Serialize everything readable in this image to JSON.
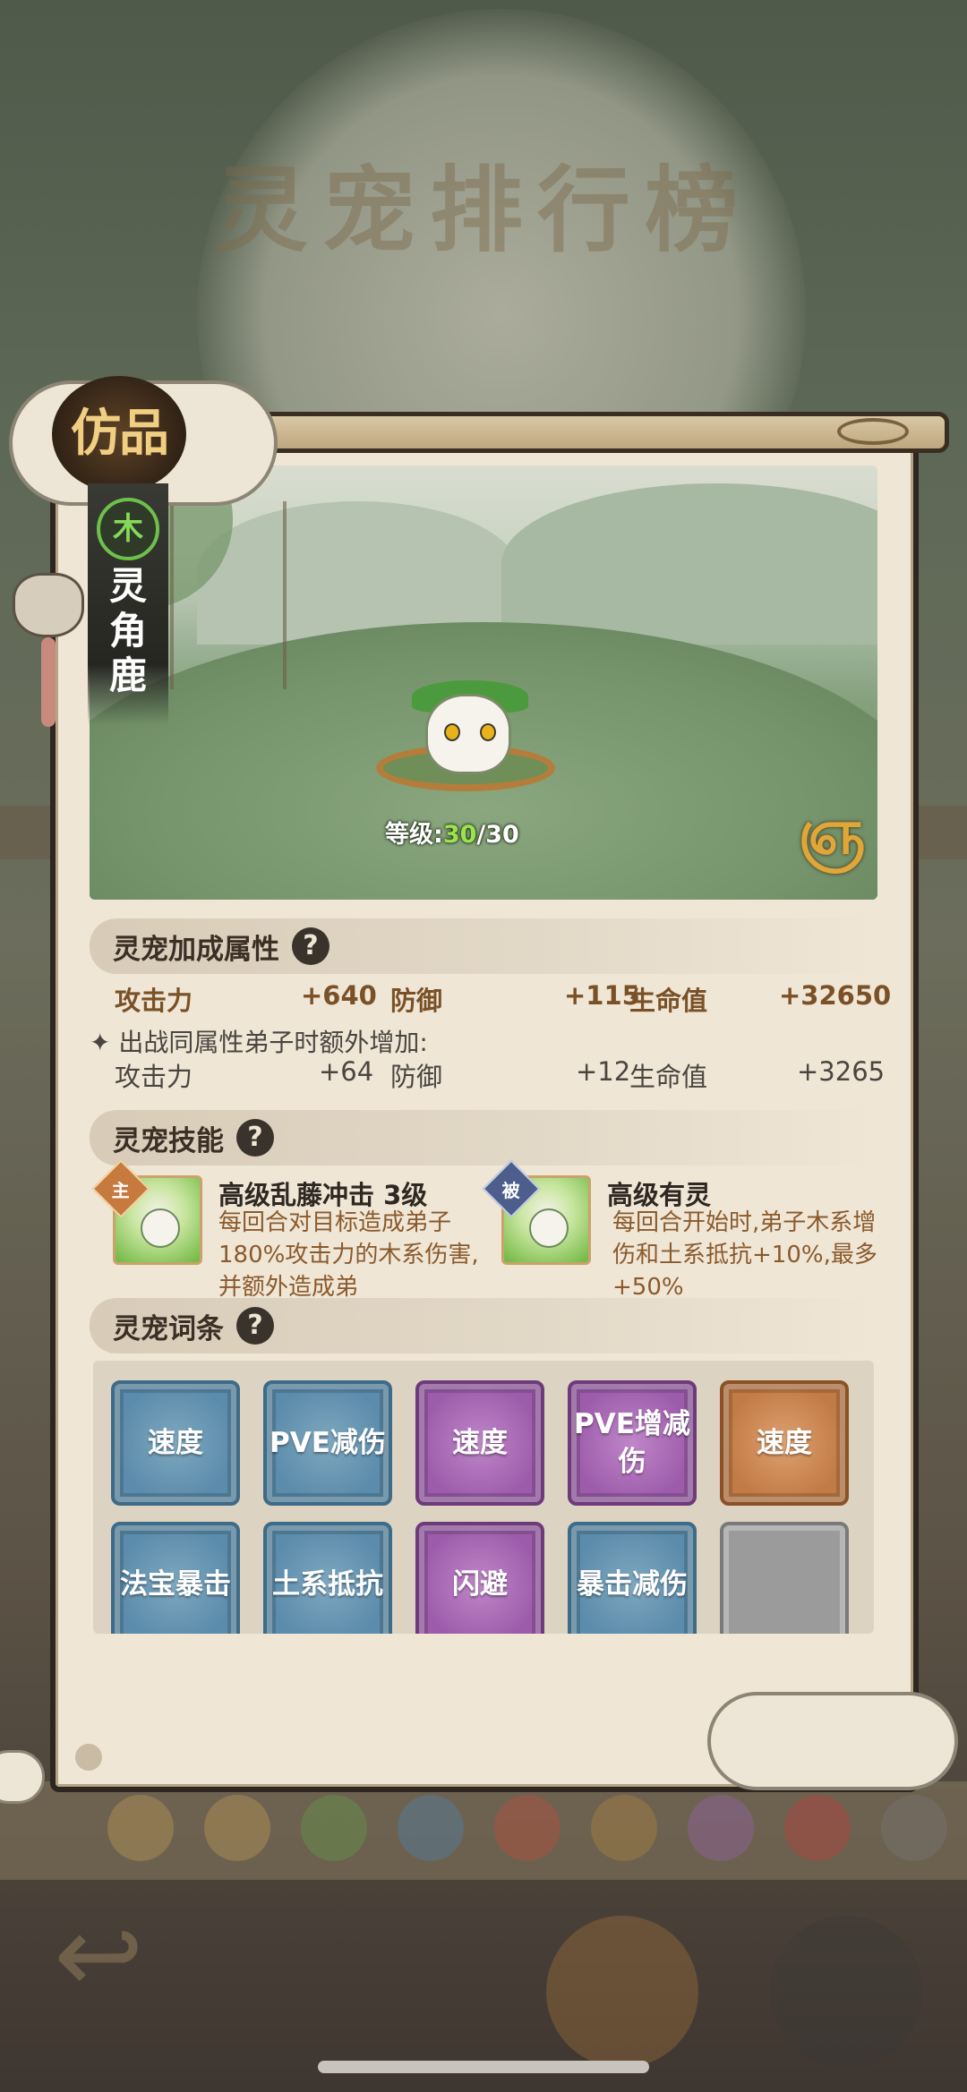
{
  "background": {
    "title": "灵宠排行榜"
  },
  "pet": {
    "grade": "仿品",
    "element": "木",
    "name": "灵角鹿",
    "level_label": "等级:",
    "level_current": "30",
    "level_max": "/30"
  },
  "attributes": {
    "title": "灵宠加成属性",
    "rows": [
      {
        "label": "攻击力",
        "value": "+640"
      },
      {
        "label": "防御",
        "value": "+115"
      },
      {
        "label": "生命值",
        "value": "+32650"
      }
    ],
    "extra_note": "出战同属性弟子时额外增加:",
    "extra_rows": [
      {
        "label": "攻击力",
        "value": "+64"
      },
      {
        "label": "防御",
        "value": "+12"
      },
      {
        "label": "生命值",
        "value": "+3265"
      }
    ]
  },
  "skills": {
    "title": "灵宠技能",
    "items": [
      {
        "tag": "主",
        "tag_color": "#c77a3e",
        "name": "高级乱藤冲击 3级",
        "desc": "每回合对目标造成弟子180%攻击力的木系伤害,并额外造成弟"
      },
      {
        "tag": "被",
        "tag_color": "#4d5e8c",
        "name": "高级有灵",
        "desc": "每回合开始时,弟子木系增伤和土系抵抗+10%,最多+50%"
      }
    ]
  },
  "traits": {
    "title": "灵宠词条",
    "items": [
      {
        "label": "速度",
        "color": "blue"
      },
      {
        "label": "PVE减伤",
        "color": "blue"
      },
      {
        "label": "速度",
        "color": "purple"
      },
      {
        "label": "PVE增减伤",
        "color": "purple"
      },
      {
        "label": "速度",
        "color": "orange"
      },
      {
        "label": "法宝暴击",
        "color": "blue"
      },
      {
        "label": "土系抵抗",
        "color": "blue"
      },
      {
        "label": "闪避",
        "color": "purple"
      },
      {
        "label": "暴击减伤",
        "color": "blue"
      },
      {
        "label": "",
        "color": "empty"
      }
    ]
  },
  "colors": {
    "panel_bg": "#efe6d6",
    "stat_main": "#7a5127",
    "level_highlight": "#9be34a",
    "element_wood": "#6ec04c"
  },
  "icons": {
    "help": "question-mark-icon",
    "spin": "cloud-swirl-icon",
    "charm": "fox-charm-icon",
    "back": "back-arrow-icon"
  }
}
